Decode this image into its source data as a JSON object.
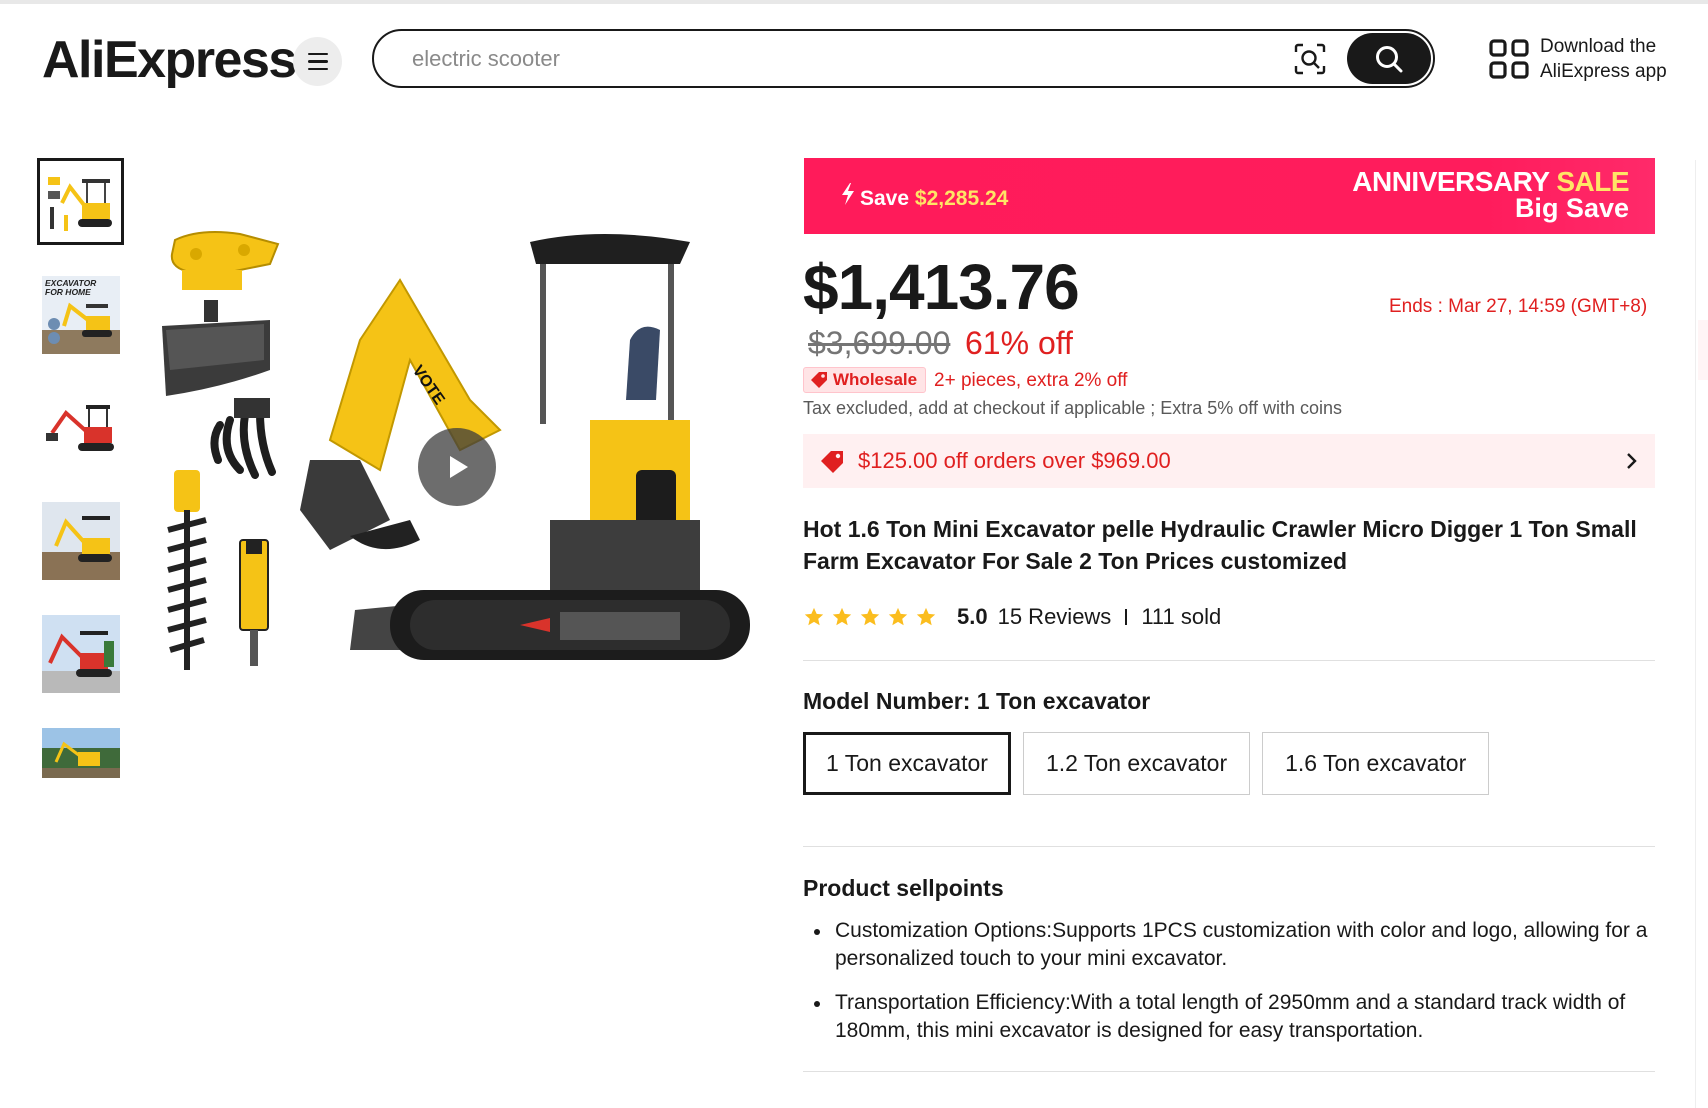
{
  "header": {
    "logo_text": "AliExpress",
    "search_placeholder": "electric scooter",
    "app_download_line1": "Download the",
    "app_download_line2": "AliExpress app"
  },
  "gallery": {
    "thumbnail_count": 6,
    "thumbnail_2_caption": "EXCAVATOR FOR HOME",
    "main_brand_text": "VOTE"
  },
  "promo": {
    "save_label": "Save ",
    "save_amount": "$2,285.24",
    "event_word1": "ANNIVERSARY ",
    "event_word2": "SALE",
    "event_sub": "Big Save"
  },
  "pricing": {
    "current_price": "$1,413.76",
    "ends_label": "Ends :  Mar 27, 14:59 (GMT+8)",
    "original_price": "$3,699.00",
    "discount": "61% off",
    "wholesale_badge": "Wholesale",
    "wholesale_detail": "2+ pieces, extra 2% off",
    "tax_note": "Tax excluded, add at checkout if applicable ; Extra 5% off with coins"
  },
  "coupon": {
    "text": "$125.00 off orders over $969.00"
  },
  "product": {
    "title": "Hot 1.6 Ton Mini Excavator pelle Hydraulic Crawler Micro Digger 1 Ton Small Farm Excavator For Sale 2 Ton Prices customized",
    "rating_stars": 5,
    "rating_score": "5.0",
    "reviews": "15 Reviews",
    "sold": "111 sold"
  },
  "model": {
    "label": "Model Number: 1 Ton excavator",
    "options": [
      "1 Ton excavator",
      "1.2 Ton excavator",
      "1.6 Ton excavator"
    ],
    "selected_index": 0
  },
  "sellpoints": {
    "title": "Product sellpoints",
    "items": [
      "Customization Options:Supports 1PCS customization with color and logo, allowing for a personalized touch to your mini excavator.",
      "Transportation Efficiency:With a total length of 2950mm and a standard track width of 180mm, this mini excavator is designed for easy transportation."
    ]
  },
  "colors": {
    "accent_red": "#e02020",
    "promo_pink": "#ff1b5a",
    "promo_yellow": "#ffe566",
    "star": "#fbbd1e",
    "machine_yellow": "#f5c316"
  },
  "icons": {
    "menu": "hamburger-icon",
    "camera": "image-search-icon",
    "search": "search-icon",
    "qr": "qr-code-icon",
    "bolt": "lightning-icon",
    "tag": "coupon-tag-icon",
    "chevron": "chevron-right-icon",
    "play": "play-icon",
    "star": "star-icon"
  }
}
